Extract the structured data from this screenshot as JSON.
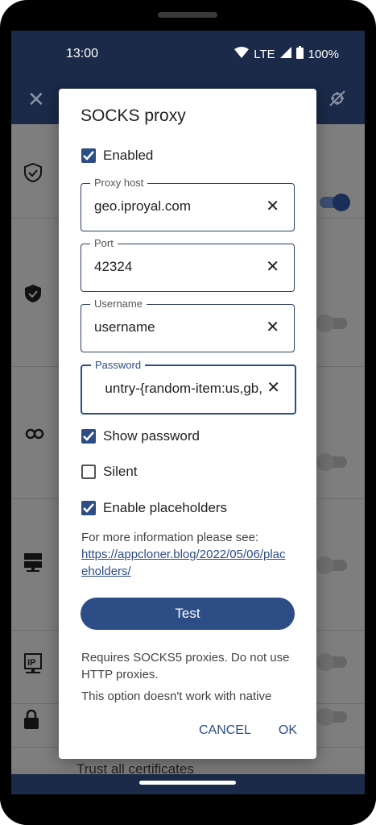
{
  "status_bar": {
    "time": "13:00",
    "network": "LTE",
    "battery": "100%"
  },
  "app_bar": {
    "close_icon": "close-icon",
    "bug_icon": "bug-icon"
  },
  "background_list": {
    "visible_text": "Trust all certificates"
  },
  "dialog": {
    "title": "SOCKS proxy",
    "enabled": {
      "label": "Enabled",
      "checked": true
    },
    "fields": [
      {
        "label": "Proxy host",
        "value": "geo.iproyal.com"
      },
      {
        "label": "Port",
        "value": "42324"
      },
      {
        "label": "Username",
        "value": "username"
      },
      {
        "label": "Password",
        "value": "untry-{random-item:us,gb,"
      }
    ],
    "show_password": {
      "label": "Show password",
      "checked": true
    },
    "silent": {
      "label": "Silent",
      "checked": false
    },
    "enable_placeholders": {
      "label": "Enable placeholders",
      "checked": true
    },
    "info_text": "For more information please see:",
    "info_link": "https://appcloner.blog/2022/05/06/placeholders/",
    "test_button": "Test",
    "note_1": "Requires SOCKS5 proxies. Do not use HTTP proxies.",
    "note_2": "This option doesn't work with native",
    "cancel": "CANCEL",
    "ok": "OK"
  },
  "colors": {
    "accent": "#2c4d86",
    "appbar": "#1a2a48",
    "scrim": "#7e7e7e"
  }
}
